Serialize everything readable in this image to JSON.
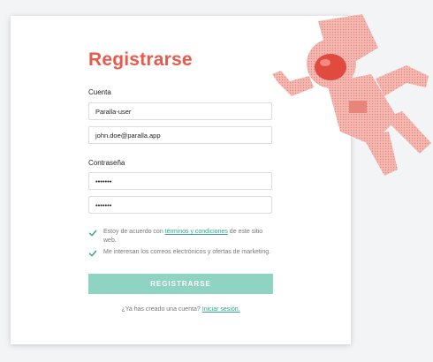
{
  "form": {
    "title": "Registrarse",
    "account_label": "Cuenta",
    "username_value": "Paralla-user",
    "email_value": "john.doe@paralla.app",
    "password_label": "Contraseña",
    "password_value": "•••••••",
    "password_confirm_value": "•••••••",
    "terms_prefix": "Estoy de acuerdo con ",
    "terms_link": "términos y condiciones",
    "terms_suffix": " de este sitio web.",
    "newsletter_text": "Me interesan los correos electrónicos y ofertas de marketing.",
    "submit_label": "REGISTRARSE",
    "footer_text": "¿Ya has creado una cuenta? ",
    "login_link": "Iniciar sesión."
  },
  "colors": {
    "accent_red": "#ea5a4b",
    "accent_green": "#2fa58a",
    "button_bg": "#8fd3c3"
  },
  "icons": {
    "checkbox_terms": "checkmark-icon",
    "checkbox_newsletter": "checkmark-icon",
    "illustration": "astronaut-illustration"
  }
}
